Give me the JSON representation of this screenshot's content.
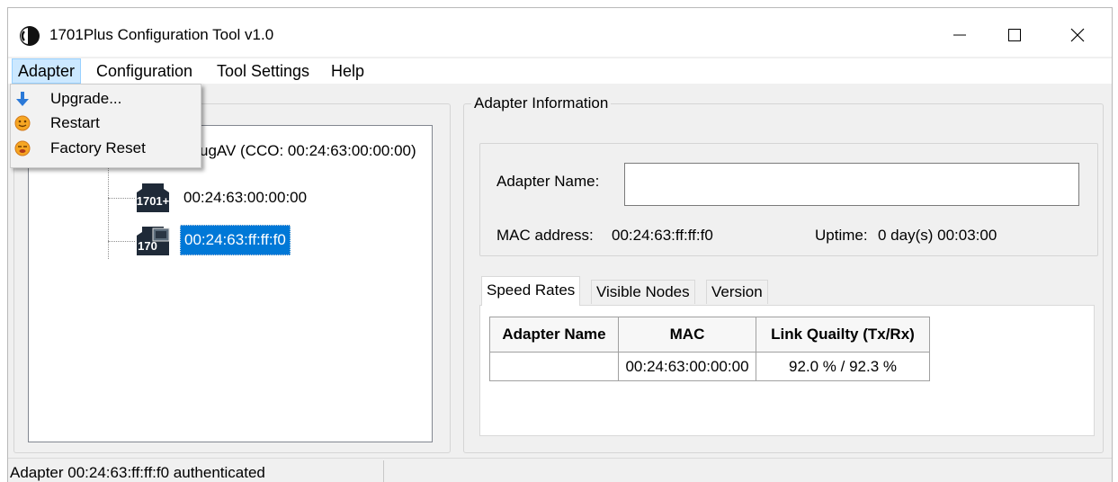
{
  "window": {
    "title": "1701Plus Configuration Tool v1.0",
    "controls": {
      "minimize": "—",
      "maximize": "☐",
      "close": "✕"
    }
  },
  "menubar": {
    "items": [
      "Adapter",
      "Configuration",
      "Tool Settings",
      "Help"
    ],
    "active": "Adapter"
  },
  "adapter_menu": {
    "items": [
      {
        "label": "Upgrade...",
        "icon": "arrow-down-icon"
      },
      {
        "label": "Restart",
        "icon": "restart-icon"
      },
      {
        "label": "Factory Reset",
        "icon": "factory-reset-icon"
      }
    ]
  },
  "tree": {
    "root_label": "ugAV (CCO: 00:24:63:00:00:00)",
    "nodes": [
      {
        "icon_label": "1701+",
        "label": "00:24:63:00:00:00",
        "selected": false
      },
      {
        "icon_label": "170",
        "label": "00:24:63:ff:ff:f0",
        "selected": true
      }
    ]
  },
  "adapter_info": {
    "group_title": "Adapter Information",
    "name_label": "Adapter Name:",
    "name_value": "",
    "mac_label": "MAC address:",
    "mac_value": "00:24:63:ff:ff:f0",
    "uptime_label": "Uptime:",
    "uptime_value": "0 day(s) 00:03:00"
  },
  "tabs": {
    "items": [
      "Speed Rates",
      "Visible Nodes",
      "Version"
    ],
    "active": "Speed Rates"
  },
  "speed_table": {
    "columns": [
      "Adapter Name",
      "MAC",
      "Link Quailty (Tx/Rx)"
    ],
    "rows": [
      {
        "adapter_name": "",
        "mac": "00:24:63:00:00:00",
        "link_quality": "92.0 % / 92.3 %"
      }
    ]
  },
  "status": {
    "message": "Adapter 00:24:63:ff:ff:f0 authenticated"
  },
  "colors": {
    "selection": "#0078d7",
    "menu_highlight": "#cce8ff",
    "window_bg": "#f0f0f0"
  }
}
